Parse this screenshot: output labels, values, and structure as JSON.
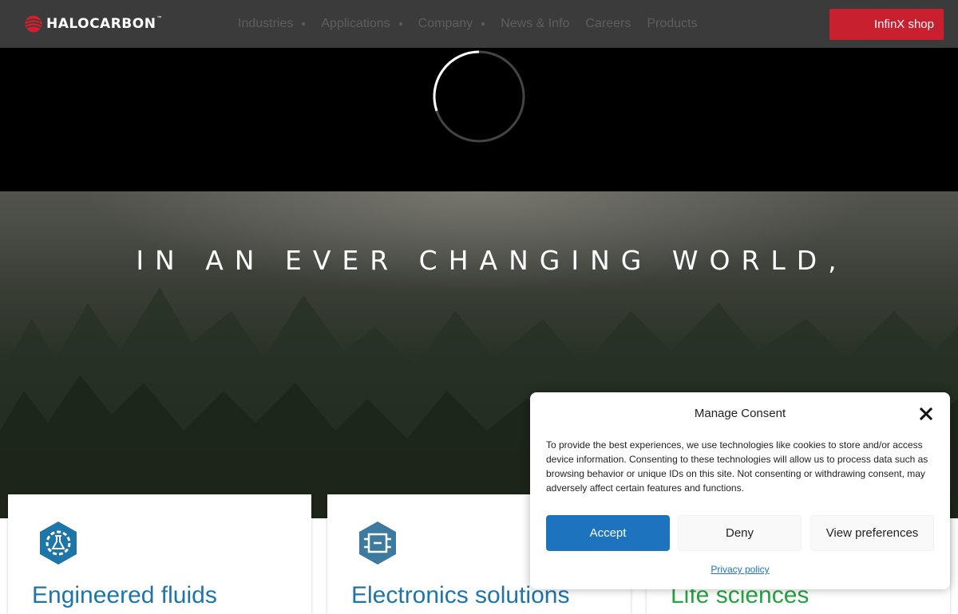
{
  "header": {
    "logo_text": "HALOCARBON",
    "logo_trademark": "™",
    "nav": [
      {
        "label": "Industries",
        "has_dropdown": true
      },
      {
        "label": "Applications",
        "has_dropdown": true
      },
      {
        "label": "Company",
        "has_dropdown": true
      },
      {
        "label": "News & Info",
        "has_dropdown": false
      },
      {
        "label": "Careers",
        "has_dropdown": false
      },
      {
        "label": "Products",
        "has_dropdown": false
      }
    ],
    "shop_button_label": "InfinX shop"
  },
  "loader": {
    "icon": "loading-spinner-icon"
  },
  "hero": {
    "heading": "IN AN EVER CHANGING WORLD,"
  },
  "cards": [
    {
      "title": "Engineered fluids",
      "icon": "flask-gear-icon"
    },
    {
      "title": "Electronics solutions",
      "icon": "circuit-chip-icon"
    },
    {
      "title": "Life sciences",
      "icon": "life-sciences-icon"
    }
  ],
  "consent": {
    "title": "Manage Consent",
    "body": "To provide the best experiences, we use technologies like cookies to store and/or access device information. Consenting to these technologies will allow us to process data such as browsing behavior or unique IDs on this site. Not consenting or withdrawing consent, may adversely affect certain features and functions.",
    "accept_label": "Accept",
    "deny_label": "Deny",
    "preferences_label": "View preferences",
    "privacy_link": "Privacy policy",
    "close_icon": "close-icon"
  },
  "colors": {
    "brand_red": "#c8202f",
    "header_bg": "#3b3b3b",
    "accept_blue": "#1e73be",
    "card_title_blue": "#1d75a8",
    "card_title_green": "#2aa245"
  }
}
